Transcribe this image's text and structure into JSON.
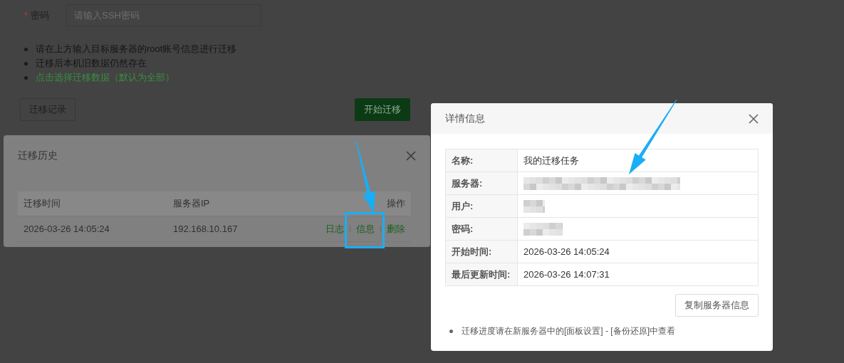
{
  "form": {
    "required_mark": "*",
    "password_label": "密码",
    "password_placeholder": "请输入SSH密码"
  },
  "notes": [
    {
      "kind": "plain",
      "text": "请在上方输入目标服务器的root账号信息进行迁移"
    },
    {
      "kind": "plain",
      "text": "迁移后本机旧数据仍然存在"
    },
    {
      "kind": "link",
      "text": "点击选择迁移数据（默认为全部）"
    }
  ],
  "buttons": {
    "history": "迁移记录",
    "start": "开始迁移"
  },
  "history_dialog": {
    "title": "迁移历史",
    "columns": [
      "迁移时间",
      "服务器IP",
      "操作"
    ],
    "rows": [
      {
        "time": "2026-03-26 14:05:24",
        "ip": "192.168.10.167",
        "actions": [
          {
            "label": "日志",
            "highlighted": false
          },
          {
            "label": "信息",
            "highlighted": true
          },
          {
            "label": "删除",
            "highlighted": false
          }
        ]
      }
    ]
  },
  "detail_dialog": {
    "title": "详情信息",
    "rows": [
      {
        "label": "名称:",
        "kind": "text",
        "value": "我的迁移任务"
      },
      {
        "label": "服务器:",
        "kind": "redacted"
      },
      {
        "label": "用户:",
        "kind": "redacted"
      },
      {
        "label": "密码:",
        "kind": "redacted"
      },
      {
        "label": "开始时间:",
        "kind": "text",
        "value": "2026-03-26 14:05:24"
      },
      {
        "label": "最后更新时间:",
        "kind": "text",
        "value": "2026-03-26 14:07:31"
      }
    ],
    "copy_button": "复制服务器信息",
    "notes": [
      "迁移进度请在新服务器中的[面板设置] - [备份还原]中查看"
    ]
  }
}
